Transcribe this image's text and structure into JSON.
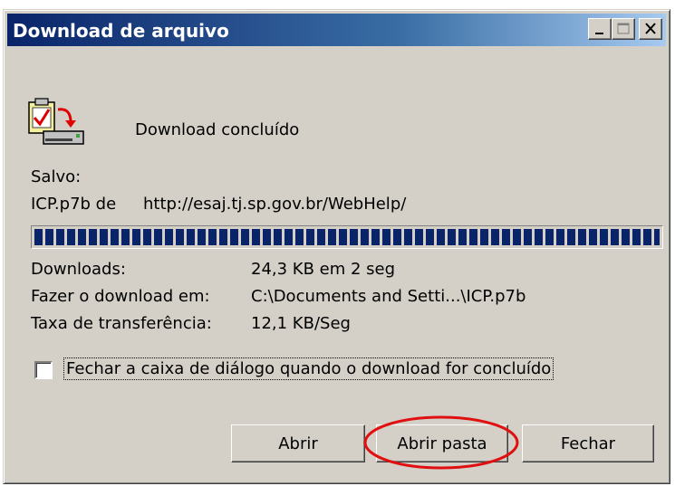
{
  "window": {
    "title": "Download de arquivo",
    "controls": [
      "minimize-icon",
      "maximize-icon",
      "close-icon"
    ]
  },
  "status": {
    "icon": "download-complete-icon",
    "text": "Download concluído"
  },
  "saved": {
    "label": "Salvo:",
    "file": "ICP.p7b de",
    "url": "http://esaj.tj.sp.gov.br/WebHelp/"
  },
  "progress": {
    "percent": 100
  },
  "details": [
    {
      "label": "Downloads:",
      "value": "24,3 KB em 2 seg"
    },
    {
      "label": "Fazer o download em:",
      "value": "C:\\Documents and Setti...\\ICP.p7b"
    },
    {
      "label": "Taxa de transferência:",
      "value": "12,1 KB/Seg"
    }
  ],
  "close_on_complete": {
    "label": "Fechar a caixa de diálogo quando o download for concluído",
    "checked": false
  },
  "buttons": {
    "open": "Abrir",
    "open_folder": "Abrir pasta",
    "close": "Fechar"
  },
  "annotation": {
    "color": "#e01010",
    "target": "open_folder"
  }
}
